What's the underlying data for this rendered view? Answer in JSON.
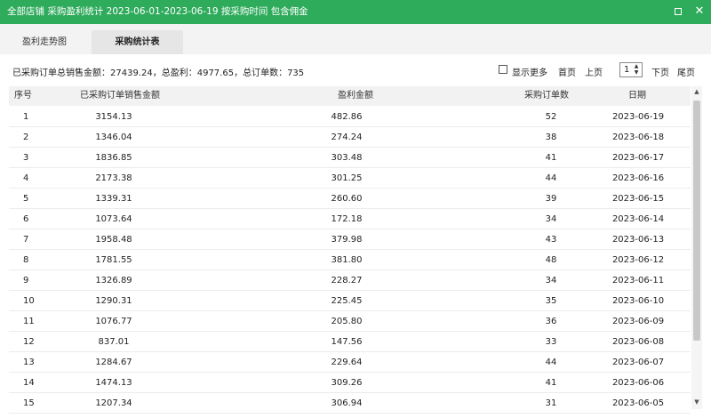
{
  "window": {
    "title": "全部店铺 采购盈利统计 2023-06-01-2023-06-19 按采购时间 包含佣金",
    "maximize_icon": "maximize-icon",
    "close_icon": "close-icon",
    "close_glyph": "✕"
  },
  "tabs": [
    {
      "label": "盈利走势图",
      "active": false
    },
    {
      "label": "采购统计表",
      "active": true
    }
  ],
  "summary": "已采购订单总销售金额：27439.24，总盈利：4977.65，总订单数：735",
  "pager": {
    "show_more_label": "显示更多",
    "show_more_checked": false,
    "first_label": "首页",
    "prev_label": "上页",
    "page_value": "1",
    "next_label": "下页",
    "last_label": "尾页"
  },
  "table": {
    "columns": [
      "序号",
      "已采购订单销售金额",
      "盈利金额",
      "采购订单数",
      "日期"
    ],
    "rows": [
      [
        "1",
        "3154.13",
        "482.86",
        "52",
        "2023-06-19"
      ],
      [
        "2",
        "1346.04",
        "274.24",
        "38",
        "2023-06-18"
      ],
      [
        "3",
        "1836.85",
        "303.48",
        "41",
        "2023-06-17"
      ],
      [
        "4",
        "2173.38",
        "301.25",
        "44",
        "2023-06-16"
      ],
      [
        "5",
        "1339.31",
        "260.60",
        "39",
        "2023-06-15"
      ],
      [
        "6",
        "1073.64",
        "172.18",
        "34",
        "2023-06-14"
      ],
      [
        "7",
        "1958.48",
        "379.98",
        "43",
        "2023-06-13"
      ],
      [
        "8",
        "1781.55",
        "381.80",
        "48",
        "2023-06-12"
      ],
      [
        "9",
        "1326.89",
        "228.27",
        "34",
        "2023-06-11"
      ],
      [
        "10",
        "1290.31",
        "225.45",
        "35",
        "2023-06-10"
      ],
      [
        "11",
        "1076.77",
        "205.80",
        "36",
        "2023-06-09"
      ],
      [
        "12",
        "837.01",
        "147.56",
        "33",
        "2023-06-08"
      ],
      [
        "13",
        "1284.67",
        "229.64",
        "44",
        "2023-06-07"
      ],
      [
        "14",
        "1474.13",
        "309.26",
        "41",
        "2023-06-06"
      ],
      [
        "15",
        "1207.34",
        "306.94",
        "31",
        "2023-06-05"
      ]
    ]
  },
  "colors": {
    "titlebar": "#2fab5c",
    "tab_active": "#e6e6e6",
    "header_bg": "#f2f2f2"
  }
}
